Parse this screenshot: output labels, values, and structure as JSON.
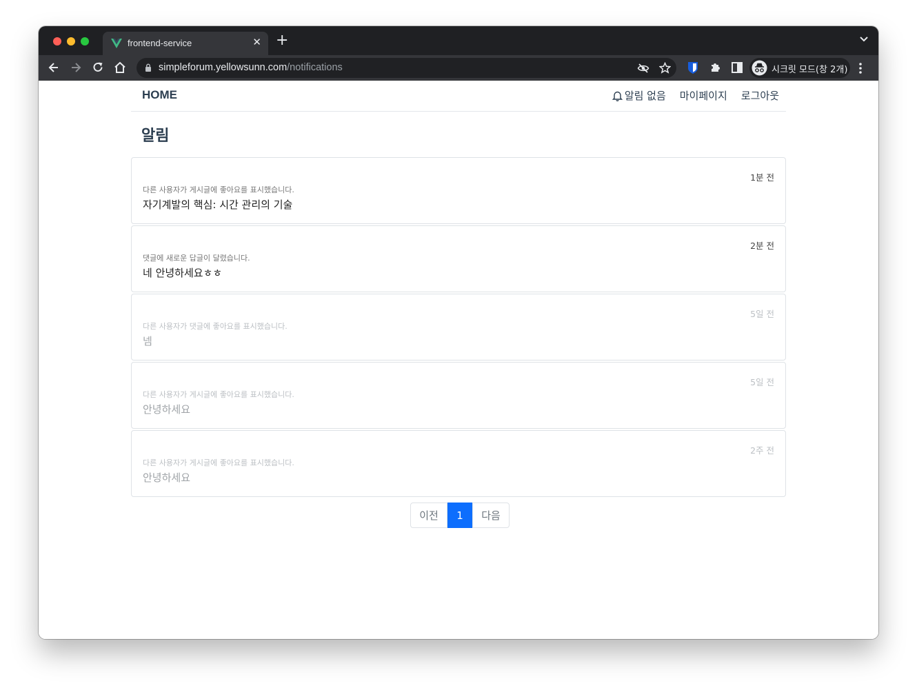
{
  "browser": {
    "tab_title": "frontend-service",
    "url_host": "simpleforum.yellowsunn.com",
    "url_path": "/notifications",
    "profile_label": "시크릿 모드(창 2개)",
    "tab_close_glyph": "✕",
    "new_tab_glyph": "+"
  },
  "nav": {
    "brand": "HOME",
    "notifications_label": "알림 없음",
    "mypage_label": "마이페이지",
    "logout_label": "로그아웃"
  },
  "page": {
    "title": "알림"
  },
  "notifications": [
    {
      "time": "1분 전",
      "kind": "다른 사용자가 게시글에 좋아요를 표시했습니다.",
      "message": "자기계발의 핵심: 시간 관리의 기술",
      "read": false
    },
    {
      "time": "2분 전",
      "kind": "댓글에 새로운 답글이 달렸습니다.",
      "message": "네 안녕하세요ㅎㅎ",
      "read": false
    },
    {
      "time": "5일 전",
      "kind": "다른 사용자가 댓글에 좋아요를 표시했습니다.",
      "message": "넴",
      "read": true
    },
    {
      "time": "5일 전",
      "kind": "다른 사용자가 게시글에 좋아요를 표시했습니다.",
      "message": "안녕하세요",
      "read": true
    },
    {
      "time": "2주 전",
      "kind": "다른 사용자가 게시글에 좋아요를 표시했습니다.",
      "message": "안녕하세요",
      "read": true
    }
  ],
  "pagination": {
    "prev_label": "이전",
    "current_page": "1",
    "next_label": "다음"
  },
  "colors": {
    "accent": "#0d6efd",
    "heading": "#2c3e50",
    "chrome_dark": "#1f2023"
  }
}
